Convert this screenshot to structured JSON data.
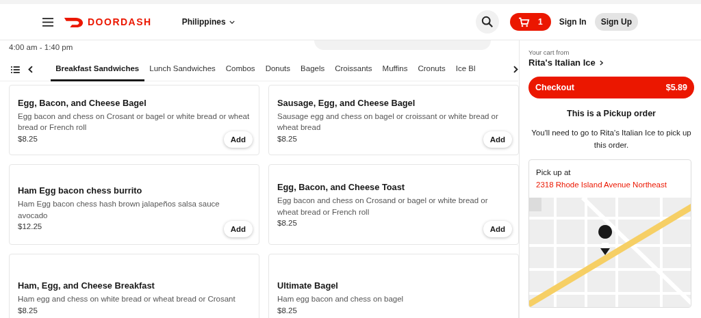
{
  "header": {
    "logo": "DOORDASH",
    "country": "Philippines",
    "cart_count": "1",
    "sign_in": "Sign In",
    "sign_up": "Sign Up"
  },
  "store": {
    "hours": "4:00 am - 1:40 pm"
  },
  "categories": [
    {
      "label": "Breakfast Sandwiches",
      "selected": true
    },
    {
      "label": "Lunch Sandwiches",
      "selected": false
    },
    {
      "label": "Combos",
      "selected": false
    },
    {
      "label": "Donuts",
      "selected": false
    },
    {
      "label": "Bagels",
      "selected": false
    },
    {
      "label": "Croissants",
      "selected": false
    },
    {
      "label": "Muffins",
      "selected": false
    },
    {
      "label": "Cronuts",
      "selected": false
    },
    {
      "label": "Ice Bl",
      "selected": false
    }
  ],
  "items": [
    {
      "name": "Egg, Bacon, and Cheese Bagel",
      "description": "Egg bacon and chess on Crosant or bagel or white bread or wheat bread or French roll",
      "price": "$8.25",
      "button": "Add"
    },
    {
      "name": "Sausage, Egg, and Cheese Bagel",
      "description": "Sausage egg and chess on bagel or croissant or white bread or wheat bread",
      "price": "$8.25",
      "button": "Add"
    },
    {
      "name": "Ham Egg bacon chess burrito",
      "description": "Ham Egg bacon chess hash brown jalapeños salsa sauce avocado",
      "price": "$12.25",
      "button": "Add"
    },
    {
      "name": "Egg, Bacon, and Cheese Toast",
      "description": "Egg bacon and chess on Crosand or bagel or white bread or wheat bread or French roll",
      "price": "$8.25",
      "button": "Add"
    },
    {
      "name": "Ham, Egg, and Cheese Breakfast",
      "description": "Ham egg and chess on white bread or wheat bread or Crosant",
      "price": "$8.25"
    },
    {
      "name": "Ultimate Bagel",
      "description": "Ham egg bacon and chess on bagel",
      "price": "$8.25"
    }
  ],
  "cart": {
    "from_label": "Your cart from",
    "store_name": "Rita's Italian Ice",
    "checkout": "Checkout",
    "total": "$5.89",
    "pickup_title": "This is a Pickup order",
    "pickup_note": "You'll need to go to Rita's Italian Ice to pick up this order.",
    "pickup_label": "Pick up at",
    "pickup_address": "2318 Rhode Island Avenue Northeast"
  }
}
